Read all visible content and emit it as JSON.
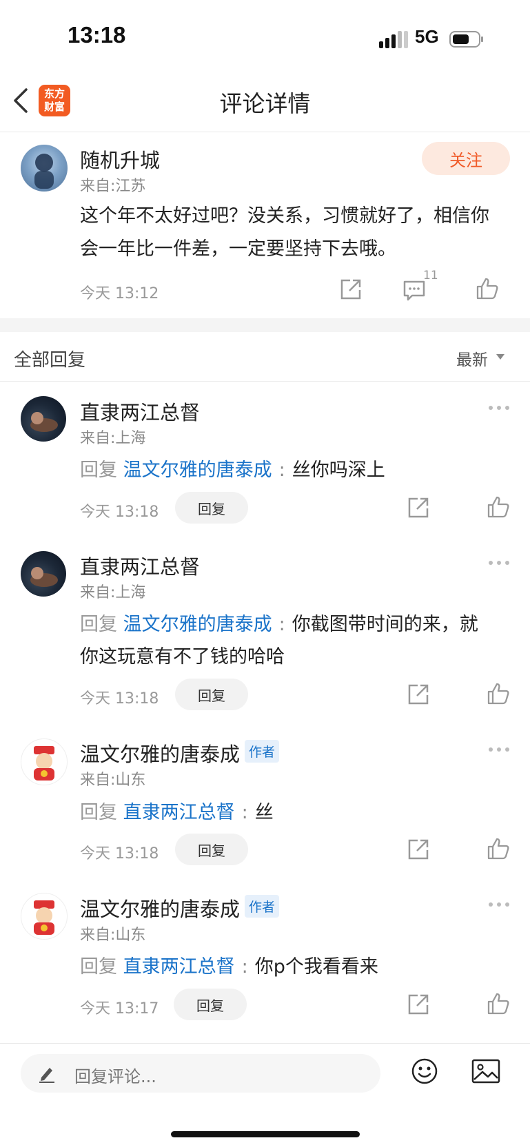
{
  "status_bar": {
    "time": "13:18",
    "network": "5G"
  },
  "nav": {
    "title": "评论详情",
    "logo_line1": "东方",
    "logo_line2": "财富"
  },
  "main_comment": {
    "username": "随机升城",
    "location": "来自:江苏",
    "follow_label": "关注",
    "text": "这个年不太好过吧？没关系，习惯就好了，相信你会一年比一件差，一定要坚持下去哦。",
    "time": "今天 13:12",
    "comment_count": "11"
  },
  "replies_header": {
    "label": "全部回复",
    "sort_label": "最新"
  },
  "replies": [
    {
      "username": "直隶两江总督",
      "location": "来自:上海",
      "reply_prefix": "回复",
      "reply_to": "温文尔雅的唐泰成",
      "colon": ":",
      "text": "丝你吗深上",
      "time": "今天 13:18",
      "reply_button": "回复"
    },
    {
      "username": "直隶两江总督",
      "location": "来自:上海",
      "reply_prefix": "回复",
      "reply_to": "温文尔雅的唐泰成",
      "colon": ":",
      "text_line1": "你截图带时间的来，就",
      "text_line2": "你这玩意有不了钱的哈哈",
      "time": "今天 13:18",
      "reply_button": "回复"
    },
    {
      "username": "温文尔雅的唐泰成",
      "author_tag": "作者",
      "location": "来自:山东",
      "reply_prefix": "回复",
      "reply_to": "直隶两江总督",
      "colon": ":",
      "text": "丝",
      "time": "今天 13:18",
      "reply_button": "回复"
    },
    {
      "username": "温文尔雅的唐泰成",
      "author_tag": "作者",
      "location": "来自:山东",
      "reply_prefix": "回复",
      "reply_to": "直隶两江总督",
      "colon": ":",
      "text": "你p个我看看来",
      "time": "今天 13:17",
      "reply_button": "回复"
    }
  ],
  "bottom_bar": {
    "placeholder": "回复评论..."
  },
  "colors": {
    "accent": "#f05a28",
    "link": "#1a73c9",
    "brand_logo": "#f25b22"
  }
}
